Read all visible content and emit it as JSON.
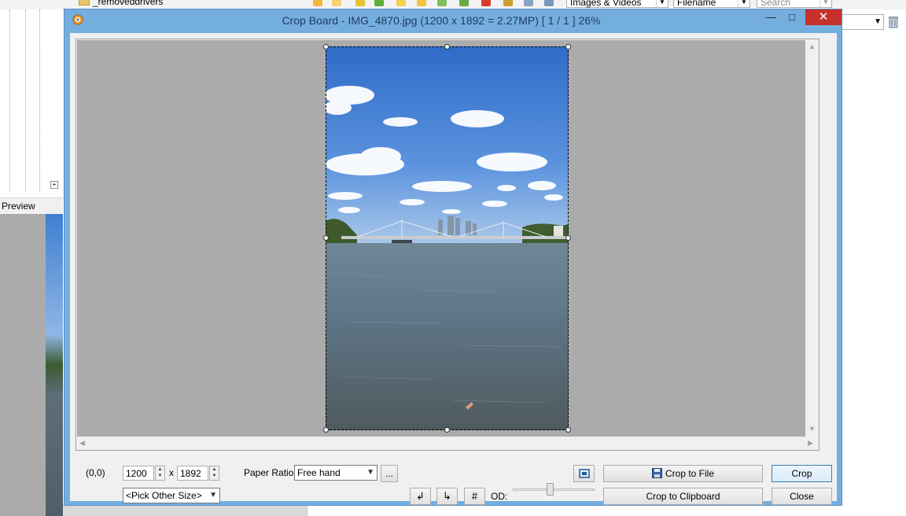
{
  "background": {
    "folder_label": "_removeddrivers",
    "filter_combo": "Images & Videos",
    "sort_combo": "Filename",
    "search_placeholder": "Search",
    "preview_label": "Preview"
  },
  "dialog": {
    "title": "Crop Board  -  IMG_4870.jpg  (1200 x 1892 = 2.27MP)  [ 1 / 1 ]   26%",
    "controls": {
      "minimize": "—",
      "maximize": "□",
      "close": "✕"
    }
  },
  "crop": {
    "origin": "(0,0)",
    "width": "1200",
    "height": "1892",
    "times": "x",
    "size_preset": "<Pick Other Size>",
    "paper_ratio_label": "Paper Ratio:",
    "paper_ratio_value": "Free hand",
    "more_button": "...",
    "od_label": "OD:",
    "od_level": 0.45
  },
  "buttons": {
    "crop_to_file": "Crop to File",
    "crop_to_clipboard": "Crop to Clipboard",
    "crop": "Crop",
    "close": "Close"
  },
  "icons": {
    "rotate_left": "rotate-left-icon",
    "rotate_right": "rotate-right-icon",
    "grid": "grid-icon",
    "fit": "fit-to-window-icon",
    "save": "floppy-disk-icon"
  },
  "colors": {
    "window_frame": "#74aede",
    "close_button": "#c7312b",
    "canvas": "#ababab"
  }
}
